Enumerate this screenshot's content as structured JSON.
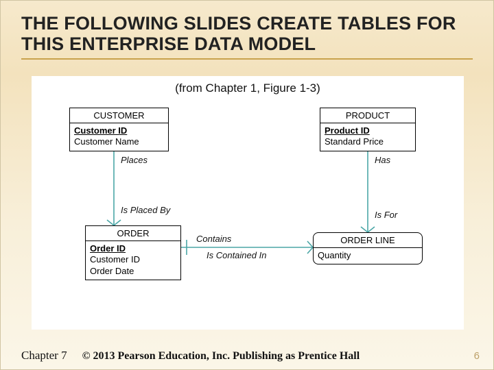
{
  "title": "THE FOLLOWING SLIDES CREATE TABLES FOR THIS ENTERPRISE DATA MODEL",
  "caption": "(from Chapter 1, Figure 1-3)",
  "entities": {
    "customer": {
      "name": "CUSTOMER",
      "pk": "Customer ID",
      "attrs": [
        "Customer Name"
      ]
    },
    "product": {
      "name": "PRODUCT",
      "pk": "Product ID",
      "attrs": [
        "Standard Price"
      ]
    },
    "order": {
      "name": "ORDER",
      "pk": "Order ID",
      "attrs": [
        "Customer ID",
        "Order Date"
      ]
    },
    "orderline": {
      "name": "ORDER LINE",
      "pk": "",
      "attrs": [
        "Quantity"
      ]
    }
  },
  "relationships": {
    "places": "Places",
    "is_placed_by": "Is Placed By",
    "has": "Has",
    "is_for": "Is For",
    "contains": "Contains",
    "is_contained_in": "Is Contained In"
  },
  "footer": {
    "chapter": "Chapter 7",
    "copyright": "© 2013 Pearson Education, Inc.  Publishing as Prentice Hall",
    "page": "6"
  },
  "colors": {
    "line": "#4aa6a6",
    "rule": "#c9a24d"
  }
}
